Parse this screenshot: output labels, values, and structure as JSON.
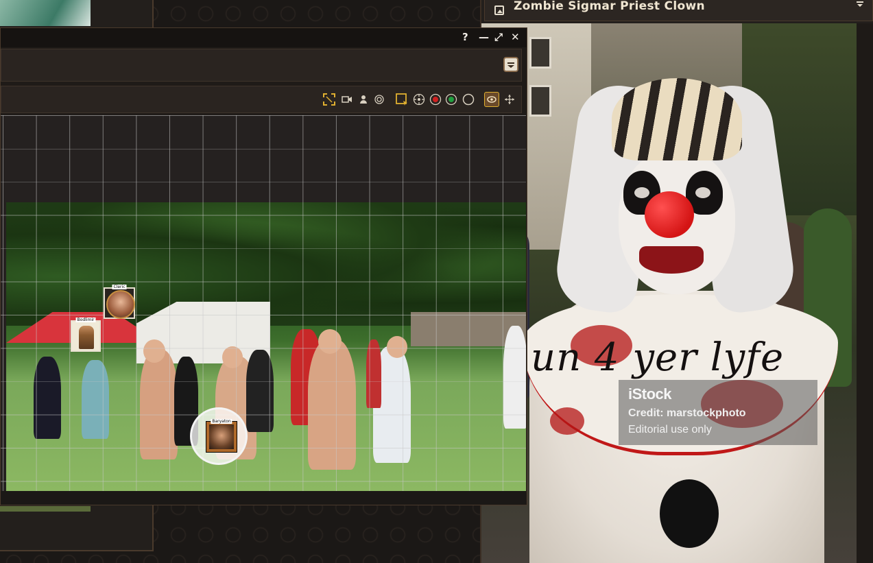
{
  "handout": {
    "title": "Zombie Sigmar Priest Clown",
    "image_caption": "un 4 yer lyfe",
    "watermark": {
      "logo": "iStock",
      "credit": "Credit: marstockphoto",
      "note": "Editorial use only"
    }
  },
  "map_window": {
    "controls": {
      "help": "?",
      "minimize": "—",
      "maximize": "⤢",
      "close": "✕"
    },
    "tokens": [
      {
        "label": "Cleric"
      },
      {
        "label": "Bodlimir"
      },
      {
        "label": "Baryaton"
      }
    ]
  },
  "colors": {
    "accent_gold": "#e0b030",
    "window_bg": "#1f1b18",
    "border": "#4a3a2c"
  }
}
